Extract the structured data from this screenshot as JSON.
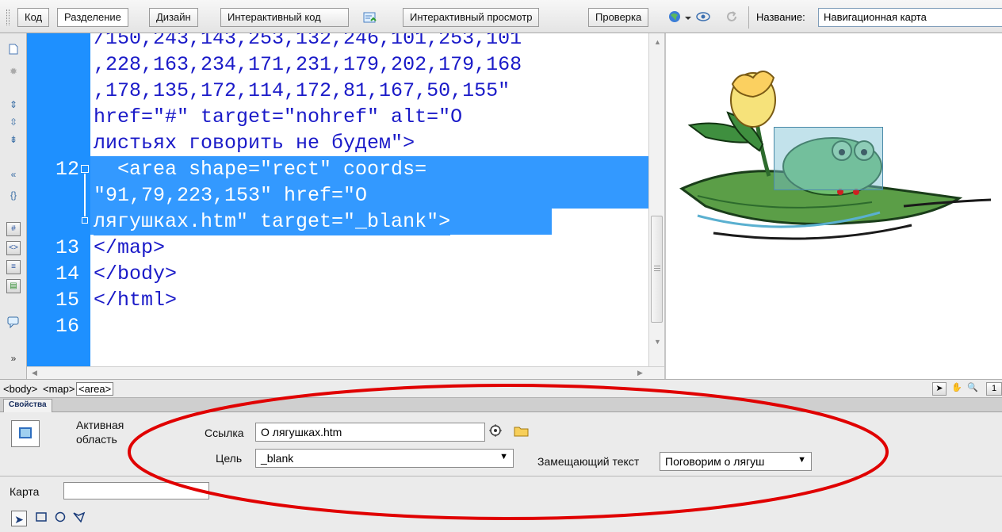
{
  "toolbar": {
    "view_code": "Код",
    "view_split": "Разделение",
    "view_design": "Дизайн",
    "live_code": "Интерактивный код",
    "live_view": "Интерактивный просмотр",
    "inspect": "Проверка",
    "title_label": "Название:",
    "title_value": "Навигационная карта"
  },
  "code": {
    "lines": [
      {
        "num": "",
        "text": "/150,243,143,253,132,246,101,253,101",
        "selected": false
      },
      {
        "num": "",
        "text": ",228,163,234,171,231,179,202,179,168",
        "selected": false
      },
      {
        "num": "",
        "text": ",178,135,172,114,172,81,167,50,155\"",
        "selected": false
      },
      {
        "num": "",
        "text": "href=\"#\" target=\"nohref\" alt=\"О",
        "selected": false
      },
      {
        "num": "",
        "text": "листьях говорить не будем\">",
        "selected": false
      },
      {
        "num": "12",
        "text": "  <area shape=\"rect\" coords=",
        "selected": true
      },
      {
        "num": "",
        "text": "\"91,79,223,153\" href=\"О",
        "selected": true
      },
      {
        "num": "",
        "text": "лягушках.htm\" target=\"_blank\">",
        "selected": true
      },
      {
        "num": "13",
        "text": "</map>",
        "selected": false
      },
      {
        "num": "14",
        "text": "</body>",
        "selected": false
      },
      {
        "num": "15",
        "text": "</html>",
        "selected": false
      },
      {
        "num": "16",
        "text": "",
        "selected": false
      }
    ]
  },
  "tagbar": {
    "tags": [
      "<body>",
      "<map>",
      "<area>"
    ],
    "active_tag": "<area>",
    "zoom_partial": "1"
  },
  "properties": {
    "panel_title": "Свойства",
    "element_type_line1": "Активная",
    "element_type_line2": "область",
    "link_label": "Ссылка",
    "link_value": "О лягушках.htm",
    "target_label": "Цель",
    "target_value": "_blank",
    "alt_label": "Замещающий текст",
    "alt_value": "Поговорим о лягуш",
    "map_label": "Карта",
    "map_value": ""
  },
  "colors": {
    "gutter": "#1e90ff",
    "selection": "#3399ff",
    "code_text": "#1a1ac8",
    "annotation": "#e00000"
  },
  "icons": {
    "hotspot_tools": [
      "pointer-icon",
      "rect-hotspot-icon",
      "circle-hotspot-icon",
      "polygon-hotspot-icon"
    ]
  }
}
